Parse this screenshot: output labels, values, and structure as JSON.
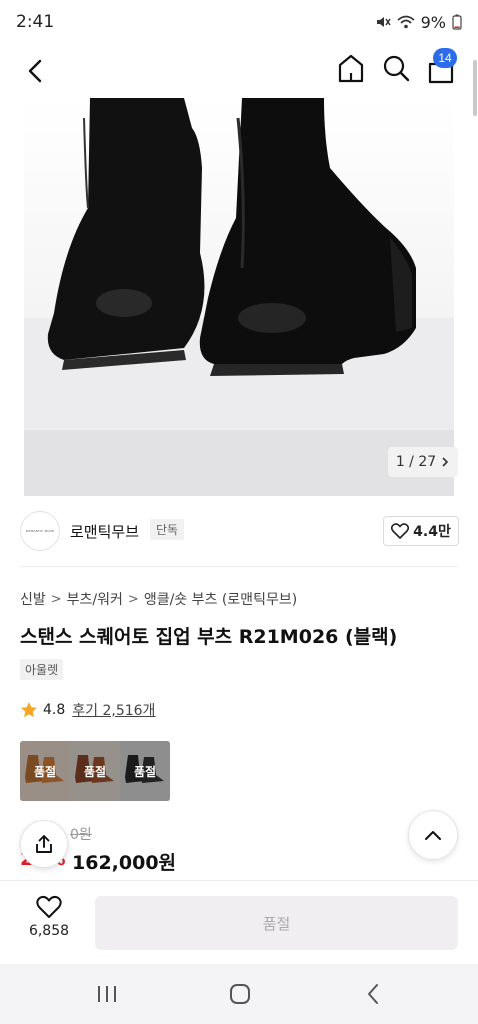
{
  "status_bar": {
    "time": "2:41",
    "battery": "9%"
  },
  "header": {
    "cart_count": "14"
  },
  "gallery": {
    "counter": "1 / 27"
  },
  "brand": {
    "name": "로맨틱무브",
    "badge": "단독",
    "logo_text": "ROMANTIC MOVE",
    "likes": "4.4만"
  },
  "breadcrumb": [
    "신발",
    "부츠/워커",
    "앵클/숏 부츠 (로맨틱무브)"
  ],
  "product": {
    "title": "스탠스 스퀘어토 집업 부츠 R21M026 (블랙)",
    "tag": "아울렛",
    "rating": "4.8",
    "reviews": "후기 2,516개",
    "options": [
      "품절",
      "품절",
      "품절"
    ],
    "original_price": "0원",
    "discount": "20%",
    "sale_price": "162,000원"
  },
  "bottom": {
    "wish_count": "6,858",
    "buy_label": "품절"
  },
  "colors": {
    "accent_blue": "#2c6bea",
    "discount_red": "#e0202a",
    "star": "#f6a623"
  }
}
